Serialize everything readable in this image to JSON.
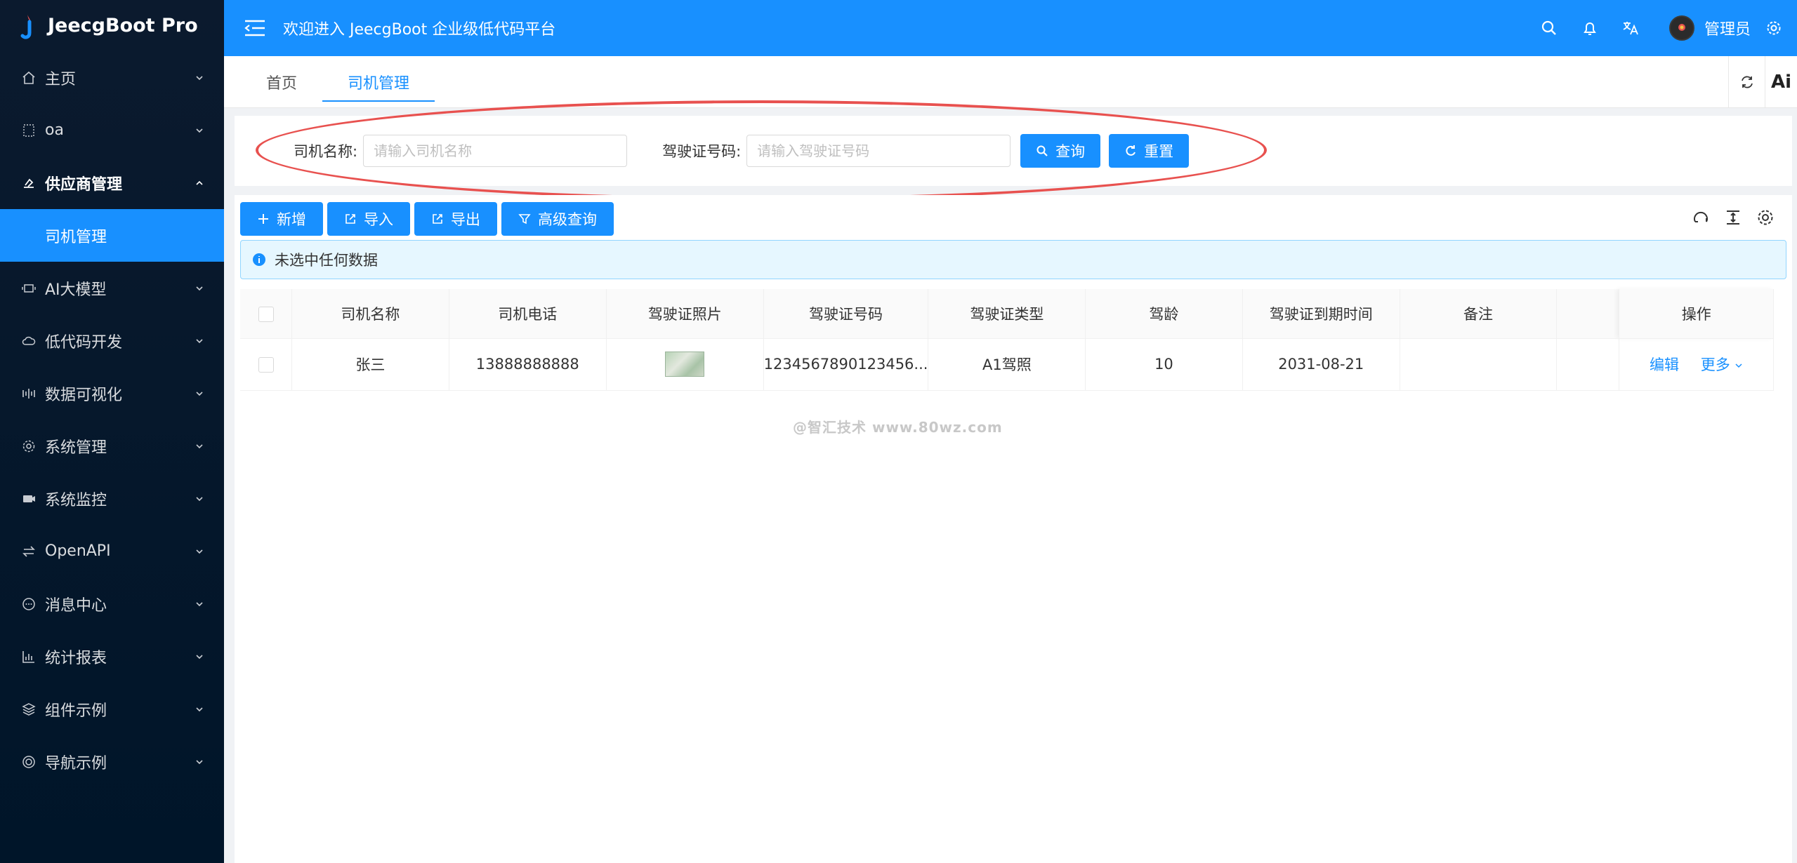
{
  "brand": {
    "name": "JeecgBoot Pro",
    "accent": "#1890ff"
  },
  "header": {
    "welcome": "欢迎进入 JeecgBoot 企业级低代码平台",
    "username": "管理员"
  },
  "sidebar": {
    "items": [
      {
        "label": "主页",
        "icon": "home-icon"
      },
      {
        "label": "oa",
        "icon": "grid-icon"
      },
      {
        "label": "供应商管理",
        "icon": "supplier-icon",
        "open": true
      },
      {
        "label": "AI大模型",
        "icon": "ai-model-icon"
      },
      {
        "label": "低代码开发",
        "icon": "cloud-icon"
      },
      {
        "label": "数据可视化",
        "icon": "chart-icon"
      },
      {
        "label": "系统管理",
        "icon": "gear-icon"
      },
      {
        "label": "系统监控",
        "icon": "monitor-icon"
      },
      {
        "label": "OpenAPI",
        "icon": "swap-icon"
      },
      {
        "label": "消息中心",
        "icon": "message-icon"
      },
      {
        "label": "统计报表",
        "icon": "bar-chart-icon"
      },
      {
        "label": "组件示例",
        "icon": "layers-icon"
      },
      {
        "label": "导航示例",
        "icon": "compass-icon"
      }
    ],
    "active_sub": "司机管理"
  },
  "tabs": [
    {
      "label": "首页",
      "active": false
    },
    {
      "label": "司机管理",
      "active": true
    }
  ],
  "tab_tools": {
    "ai_label": "Ai"
  },
  "search": {
    "driver_name_label": "司机名称:",
    "driver_name_placeholder": "请输入司机名称",
    "license_no_label": "驾驶证号码:",
    "license_no_placeholder": "请输入驾驶证号码",
    "query_label": "查询",
    "reset_label": "重置"
  },
  "toolbar": {
    "add_label": "新增",
    "import_label": "导入",
    "export_label": "导出",
    "advanced_query_label": "高级查询"
  },
  "alert": {
    "text": "未选中任何数据"
  },
  "table": {
    "columns": [
      "司机名称",
      "司机电话",
      "驾驶证照片",
      "驾驶证号码",
      "驾驶证类型",
      "驾龄",
      "驾驶证到期时间",
      "备注",
      "",
      "操作"
    ],
    "rows": [
      {
        "name": "张三",
        "phone": "13888888888",
        "license_no": "1234567890123456...",
        "license_type": "A1驾照",
        "years": "10",
        "expire": "2031-08-21",
        "remark": "",
        "edit_label": "编辑",
        "more_label": "更多"
      }
    ]
  },
  "watermark": {
    "text": "@智汇技术 www.80wz.com"
  }
}
